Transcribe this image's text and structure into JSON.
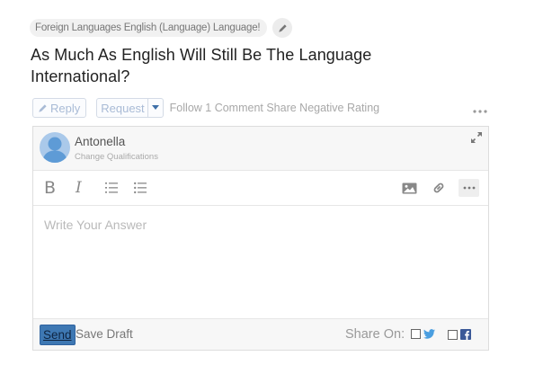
{
  "topics": {
    "tags_text": "Foreign Languages English (Language) Language!"
  },
  "question": {
    "title": "As Much As English Will Still Be The Language International?"
  },
  "actions": {
    "reply_label": "Reply",
    "request_label": "Request",
    "links_text": "Follow 1 Comment Share Negative Rating"
  },
  "editor": {
    "author_name": "Antonella",
    "author_credential": "Change Qualifications",
    "placeholder": "Write Your Answer",
    "send_label": "Send",
    "save_draft_label": "Save Draft",
    "share_label": "Share On:"
  },
  "colors": {
    "accent": "#3e78b3",
    "twitter": "#4a9ee0",
    "facebook": "#3b5998",
    "muted_blue": "#a9bbd6"
  },
  "icons": {
    "edit_topics": "pencil-icon",
    "reply": "pencil-icon",
    "request_dropdown": "caret-down-icon",
    "more": "ellipsis-icon",
    "avatar": "user-avatar-icon",
    "expand": "expand-icon",
    "bold": "bold-icon",
    "italic": "italic-icon",
    "ordered_list": "ordered-list-icon",
    "unordered_list": "unordered-list-icon",
    "image": "image-icon",
    "link": "link-icon",
    "twitter": "twitter-icon",
    "facebook": "facebook-icon"
  }
}
